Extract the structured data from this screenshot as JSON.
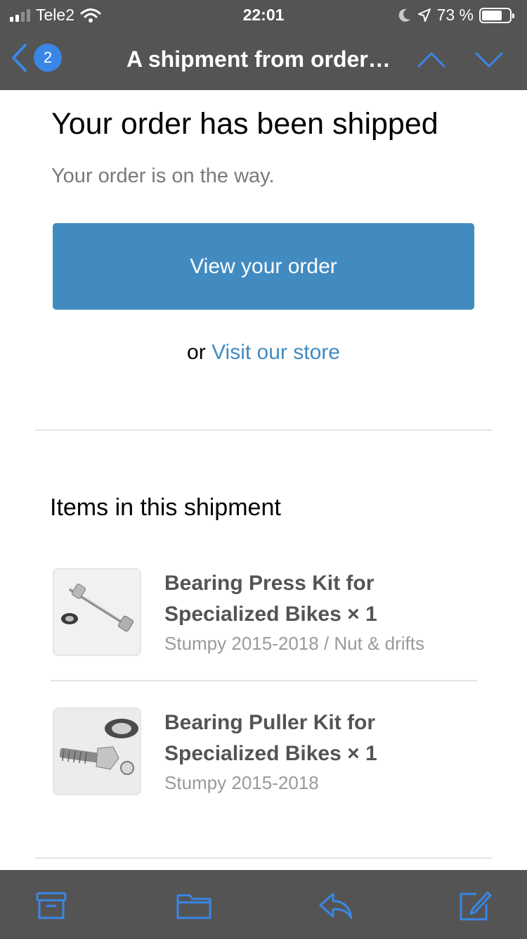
{
  "status_bar": {
    "carrier": "Tele2",
    "time": "22:01",
    "battery": "73 %",
    "battery_level": 0.73
  },
  "nav": {
    "unread_count": "2",
    "title": "A shipment from order…"
  },
  "email": {
    "heading": "Your order has been shipped",
    "subheading": "Your order is on the way.",
    "view_order_button": "View your order",
    "or_text": "or",
    "visit_store_link": "Visit our store",
    "items_heading": "Items in this shipment",
    "items": [
      {
        "title": "Bearing Press Kit for Specialized Bikes × 1",
        "variant": "Stumpy 2015-2018 / Nut & drifts"
      },
      {
        "title": "Bearing Puller Kit for Specialized Bikes × 1",
        "variant": "Stumpy 2015-2018"
      }
    ]
  },
  "toolbar": {
    "icons": [
      "archive-icon",
      "folder-icon",
      "reply-icon",
      "compose-icon"
    ]
  },
  "colors": {
    "accent": "#428bc1",
    "ios_blue": "#3a86e6",
    "bar_bg": "#545454"
  }
}
